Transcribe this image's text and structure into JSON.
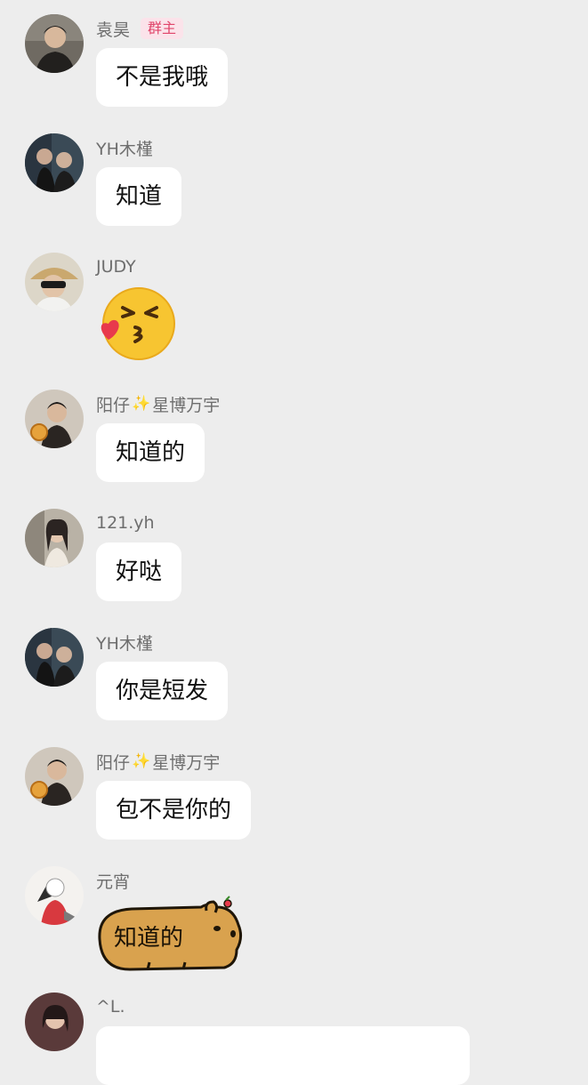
{
  "colors": {
    "background": "#ededed",
    "bubble": "#ffffff",
    "sender_name": "#6e6e6e",
    "owner_badge_text": "#e0446a",
    "owner_badge_bg": "#fbe3ea"
  },
  "messages": [
    {
      "sender": "袁昊",
      "badge": "群主",
      "type": "text",
      "text": "不是我哦"
    },
    {
      "sender": "YH木槿",
      "type": "text",
      "text": "知道"
    },
    {
      "sender": "JUDY",
      "type": "emoji",
      "emoji": "kiss-face-with-heart"
    },
    {
      "sender_parts": [
        "阳仔",
        "✨",
        "星博万宇"
      ],
      "type": "text",
      "text": "知道的"
    },
    {
      "sender": "121.yh",
      "type": "text",
      "text": "好哒"
    },
    {
      "sender": "YH木槿",
      "type": "text",
      "text": "你是短发"
    },
    {
      "sender_parts": [
        "阳仔",
        "✨",
        "星博万宇"
      ],
      "type": "text",
      "text": "包不是你的"
    },
    {
      "sender": "元宵",
      "type": "sticker",
      "sticker": "capybara",
      "text": "知道的"
    },
    {
      "sender": "^L.",
      "type": "text",
      "text": ""
    }
  ]
}
